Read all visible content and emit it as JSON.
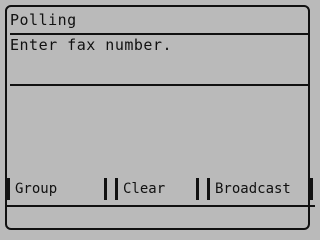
{
  "screen": {
    "title": "Polling",
    "prompt": "Enter fax number.",
    "fax_input": {
      "value": "",
      "placeholder": ""
    }
  },
  "softkeys": [
    {
      "label": "Group"
    },
    {
      "label": "Clear"
    },
    {
      "label": "Broadcast"
    }
  ],
  "colors": {
    "background": "#d2d2d2",
    "ink": "#111111"
  }
}
